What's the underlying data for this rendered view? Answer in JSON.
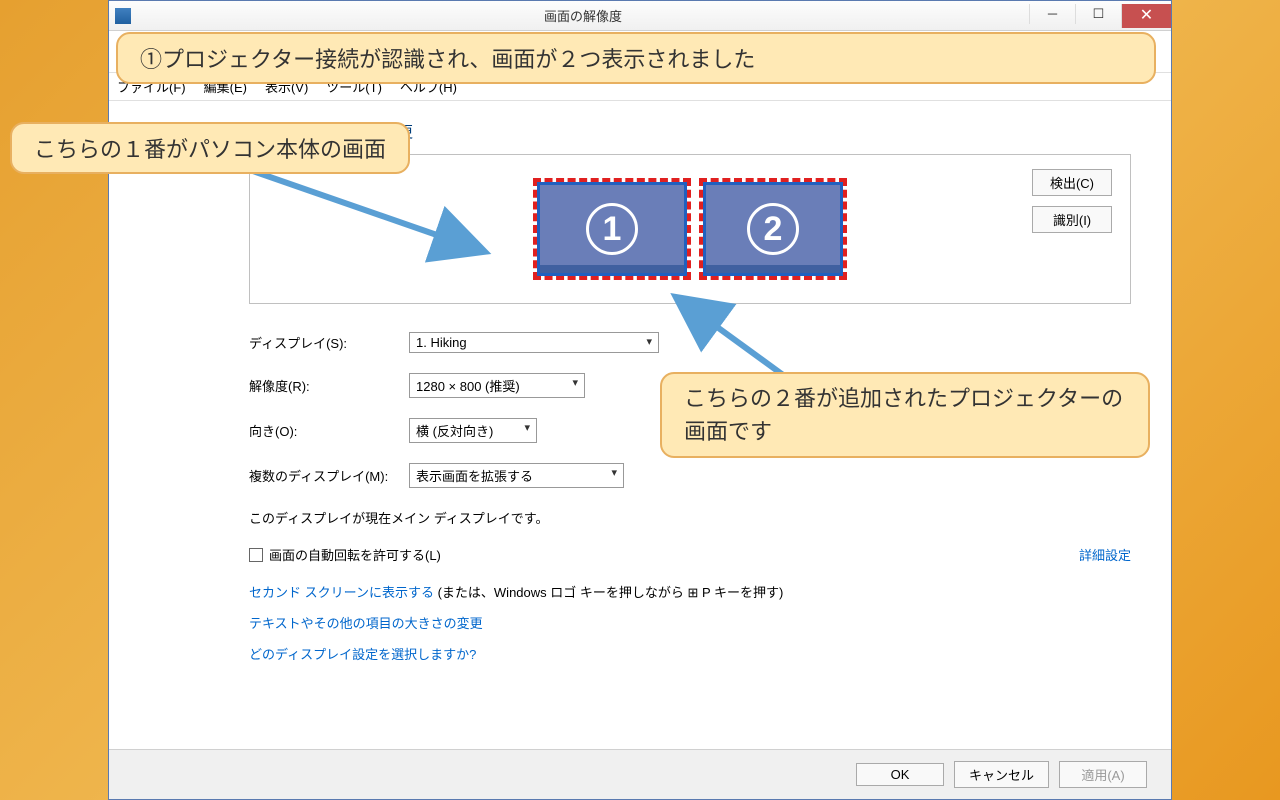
{
  "window": {
    "title": "画面の解像度"
  },
  "menu": {
    "file": "ファイル(F)",
    "edit": "編集(E)",
    "view": "表示(V)",
    "tools": "ツール(T)",
    "help": "ヘルプ(H)"
  },
  "heading": "ディスプレイ表示の変更",
  "buttons": {
    "detect": "検出(C)",
    "identify": "識別(I)",
    "ok": "OK",
    "cancel": "キャンセル",
    "apply": "適用(A)"
  },
  "screens": {
    "s1": "1",
    "s2": "2"
  },
  "labels": {
    "display": "ディスプレイ(S):",
    "resolution": "解像度(R):",
    "orientation": "向き(O):",
    "multi": "複数のディスプレイ(M):"
  },
  "values": {
    "display": "1. Hiking",
    "resolution": "1280 × 800 (推奨)",
    "orientation": "横 (反対向き)",
    "multi": "表示画面を拡張する"
  },
  "status": "このディスプレイが現在メイン ディスプレイです。",
  "checkbox": "画面の自動回転を許可する(L)",
  "advanced": "詳細設定",
  "links": {
    "l1a": "セカンド スクリーンに表示する",
    "l1b": " (または、Windows ロゴ キーを押しながら ",
    "l1c": " P キーを押す)",
    "l2": "テキストやその他の項目の大きさの変更",
    "l3": "どのディスプレイ設定を選択しますか?"
  },
  "callouts": {
    "c1": "①プロジェクター接続が認識され、画面が２つ表示されました",
    "c2": "こちらの１番がパソコン本体の画面",
    "c3": "こちらの２番が追加されたプロジェクターの画面です"
  }
}
